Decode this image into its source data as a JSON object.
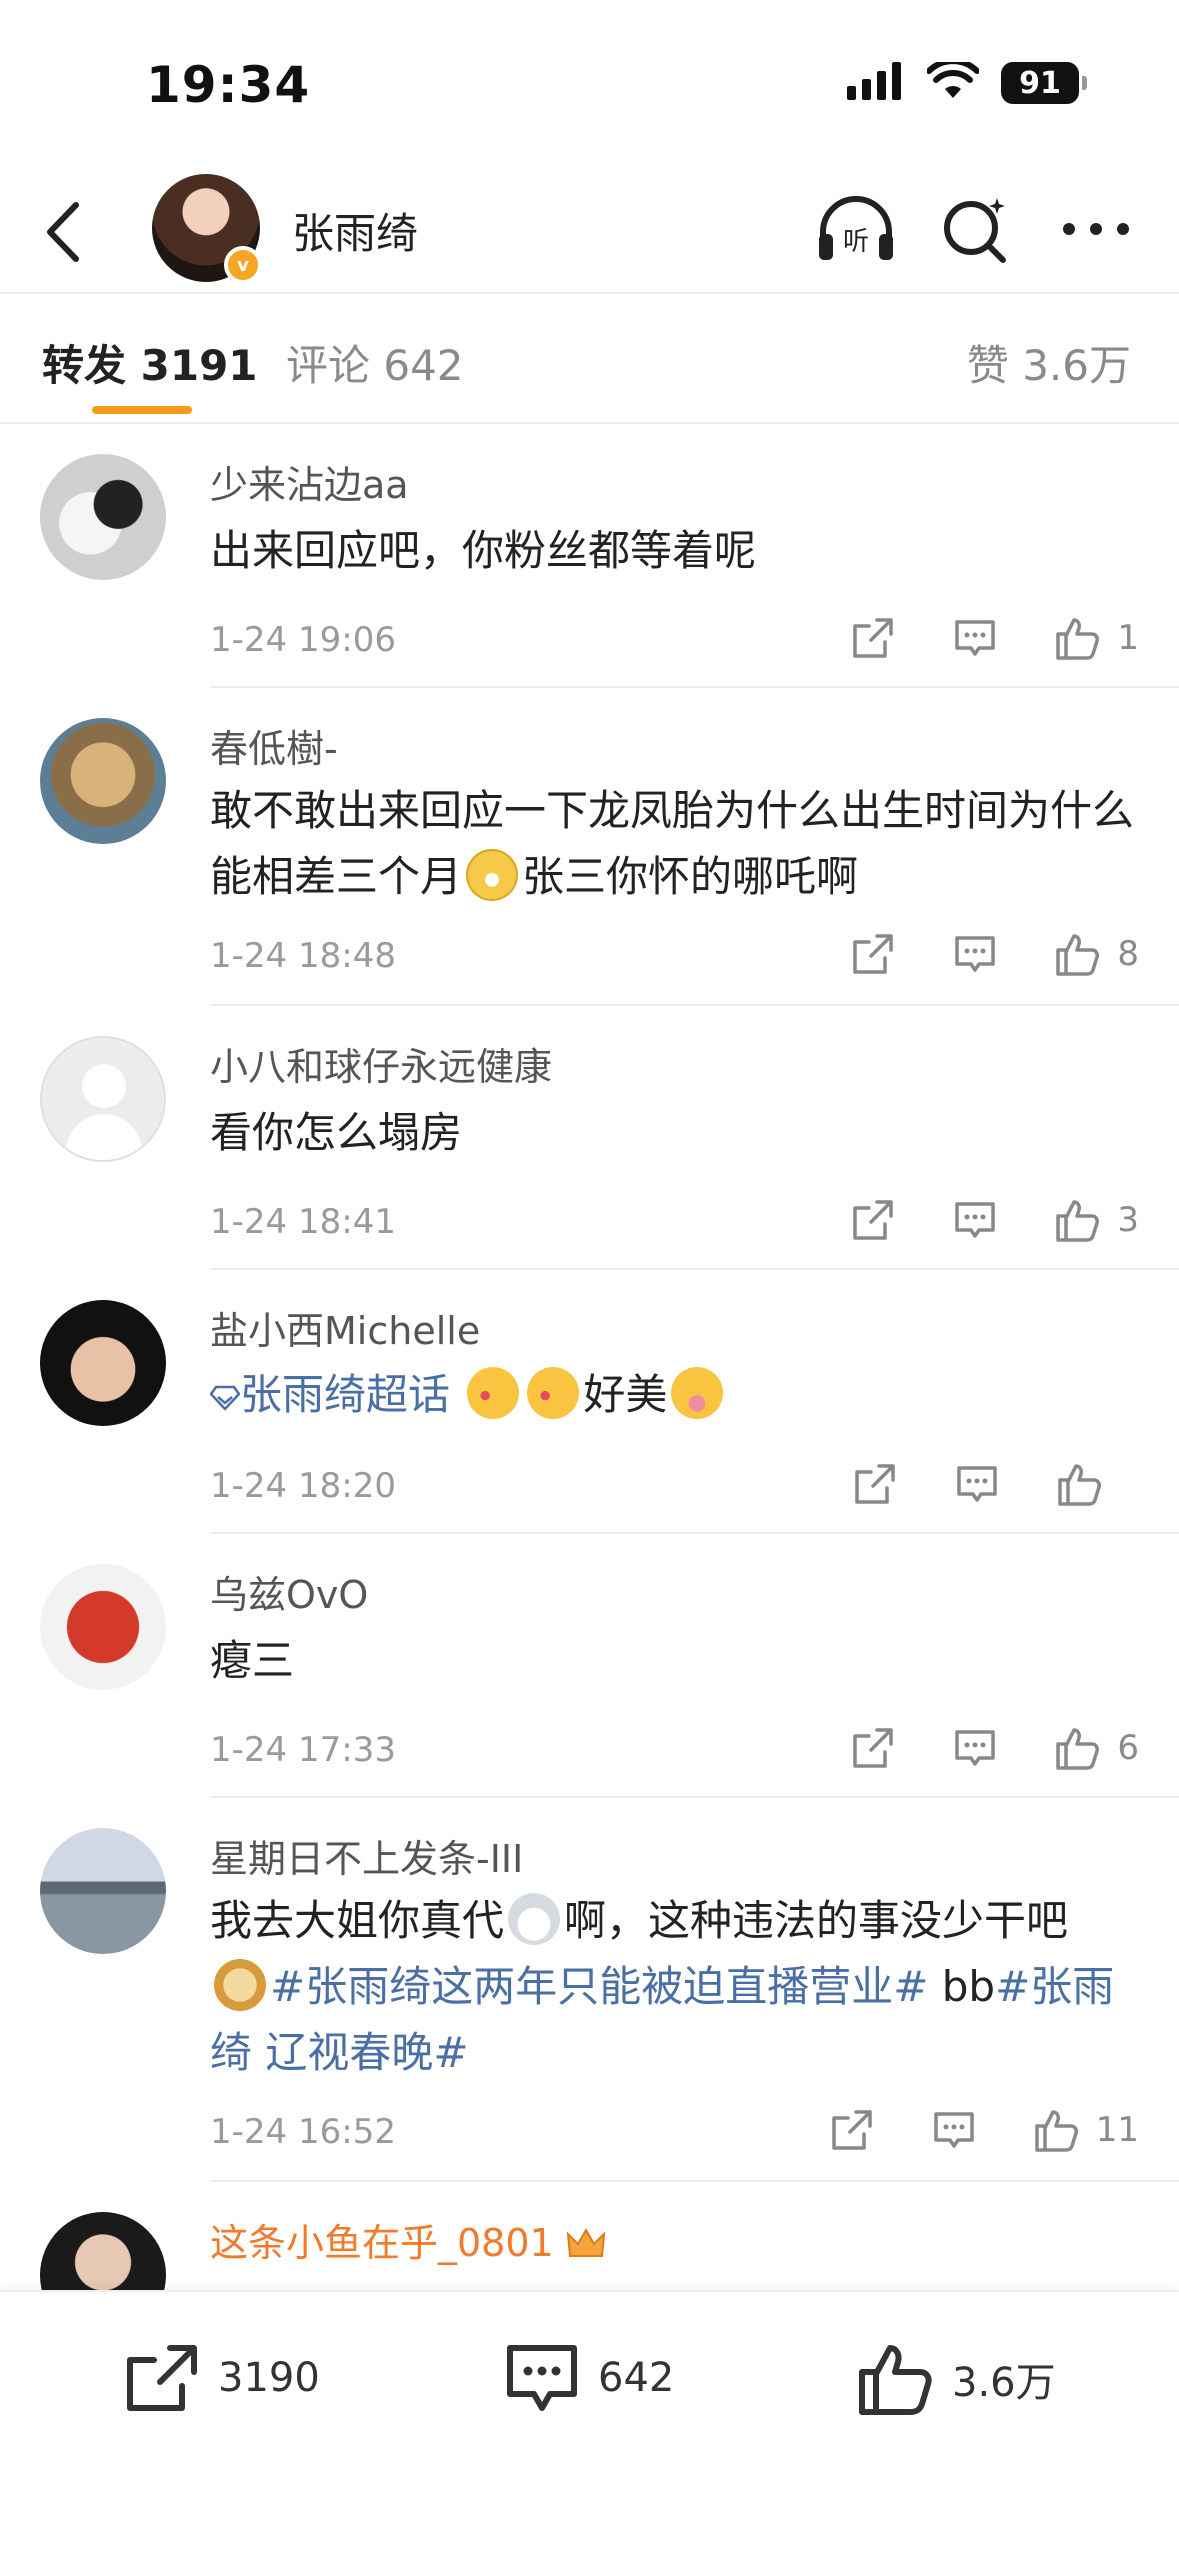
{
  "status_bar": {
    "time": "19:34",
    "battery": "91"
  },
  "header": {
    "name": "张雨绮"
  },
  "tabs": {
    "repost": "转发 3191",
    "comment": "评论 642",
    "like": "赞 3.6万"
  },
  "items": [
    {
      "user": "少来沾边aa",
      "content": "出来回应吧，你粉丝都等着呢",
      "time": "1-24 19:06",
      "likes": "1"
    },
    {
      "user": "春低樹-",
      "content_a": "敢不敢出来回应一下龙凤胎为什么出生时间为什么能相差三个月",
      "content_b": "张三你怀的哪吒啊",
      "time": "1-24 18:48",
      "likes": "8"
    },
    {
      "user": "小八和球仔永远健康",
      "content": "看你怎么塌房",
      "time": "1-24 18:41",
      "likes": "3"
    },
    {
      "user": "盐小西Michelle",
      "tag": "张雨绮超话",
      "content_b": "好美",
      "time": "1-24 18:20",
      "likes": ""
    },
    {
      "user": "乌兹OvO",
      "content": "瘪三",
      "time": "1-24 17:33",
      "likes": "6"
    },
    {
      "user": "星期日不上发条-III",
      "content_a": "我去大姐你真代",
      "content_b": "啊，这种违法的事没少干吧",
      "tag_a": "#张雨绮这两年只能被迫直播营业#",
      "content_c": " bb",
      "tag_b": "#张雨绮 辽视春晚#",
      "time": "1-24 16:52",
      "likes": "11"
    },
    {
      "user": "这条小鱼在乎_0801"
    }
  ],
  "bottom_bar": {
    "repost": "3190",
    "comment": "642",
    "like": "3.6万"
  },
  "colors": {
    "accent": "#f39c1b",
    "link": "#4a6fa5",
    "username_highlight": "#f07b2c"
  }
}
